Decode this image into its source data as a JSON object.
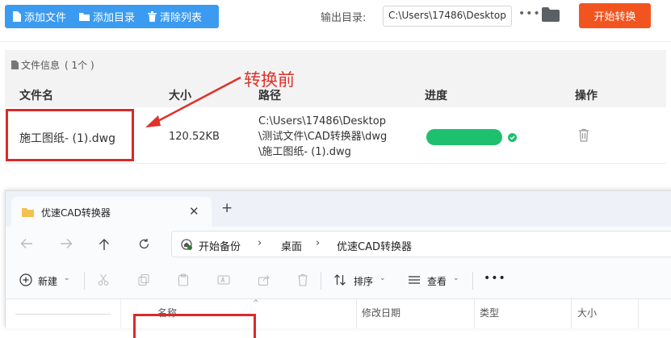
{
  "toolbar": {
    "add_file": "添加文件",
    "add_dir": "添加目录",
    "clear_list": "清除列表",
    "output_label": "输出目录:",
    "output_path": "C:\\Users\\17486\\Desktop",
    "more": "•••",
    "start": "开始转换"
  },
  "info": {
    "label": "文件信息",
    "count": "( 1个 )"
  },
  "table": {
    "headers": {
      "name": "文件名",
      "size": "大小",
      "path": "路径",
      "progress": "进度",
      "action": "操作"
    },
    "row": {
      "name": "施工图纸- (1).dwg",
      "size": "120.52KB",
      "path_line1": "C:\\Users\\17486\\Desktop",
      "path_line2": "\\测试文件\\CAD转换器\\dwg",
      "path_line3": "\\施工图纸- (1).dwg",
      "progress": 1.0
    }
  },
  "annotation": {
    "label": "转换前",
    "color": "#e0322b"
  },
  "explorer": {
    "tab_title": "优速CAD转换器",
    "breadcrumb": [
      "开始备份",
      "桌面",
      "优速CAD转换器"
    ],
    "commands": {
      "new": "新建",
      "sort": "排序",
      "view": "查看"
    },
    "columns": {
      "name": "名称",
      "modified": "修改日期",
      "type": "类型",
      "size": "大小"
    }
  },
  "colors": {
    "primary": "#3b9bf0",
    "start": "#f2541f",
    "progress": "#1ec06d",
    "annotation": "#d82b2b"
  }
}
